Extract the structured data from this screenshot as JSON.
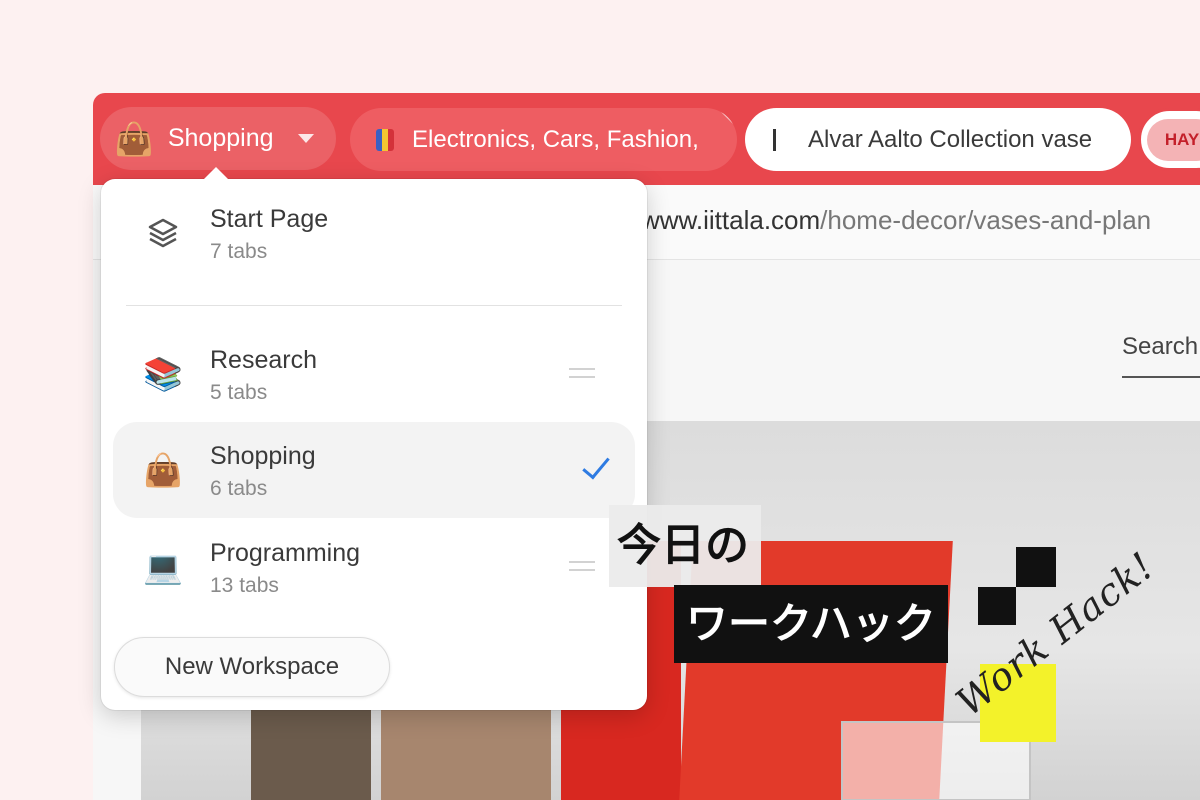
{
  "tabbar": {
    "workspace_chip": {
      "emoji": "👜",
      "label": "Shopping"
    },
    "tabs": [
      {
        "label": "Electronics, Cars, Fashion,"
      },
      {
        "label": "Alvar Aalto Collection vase"
      },
      {
        "label": "HAY"
      }
    ]
  },
  "address_bar": {
    "domain": "www.iittala.com",
    "path": "/home-decor/vases-and-plan"
  },
  "page": {
    "search_label": "Search"
  },
  "workspace_menu": {
    "start_page": {
      "name": "Start Page",
      "count": "7 tabs"
    },
    "workspaces": [
      {
        "emoji": "📚",
        "name": "Research",
        "count": "5 tabs",
        "selected": false
      },
      {
        "emoji": "👜",
        "name": "Shopping",
        "count": "6 tabs",
        "selected": true
      },
      {
        "emoji": "💻",
        "name": "Programming",
        "count": "13 tabs",
        "selected": false
      }
    ],
    "new_workspace_label": "New Workspace"
  },
  "overlay": {
    "title_line1": "今日の",
    "title_line2": "ワークハック",
    "signature": "Work Hack!"
  },
  "colors": {
    "tabbar": "#e8474d",
    "check": "#2e7be2",
    "accent_yellow": "#f3f22a"
  }
}
